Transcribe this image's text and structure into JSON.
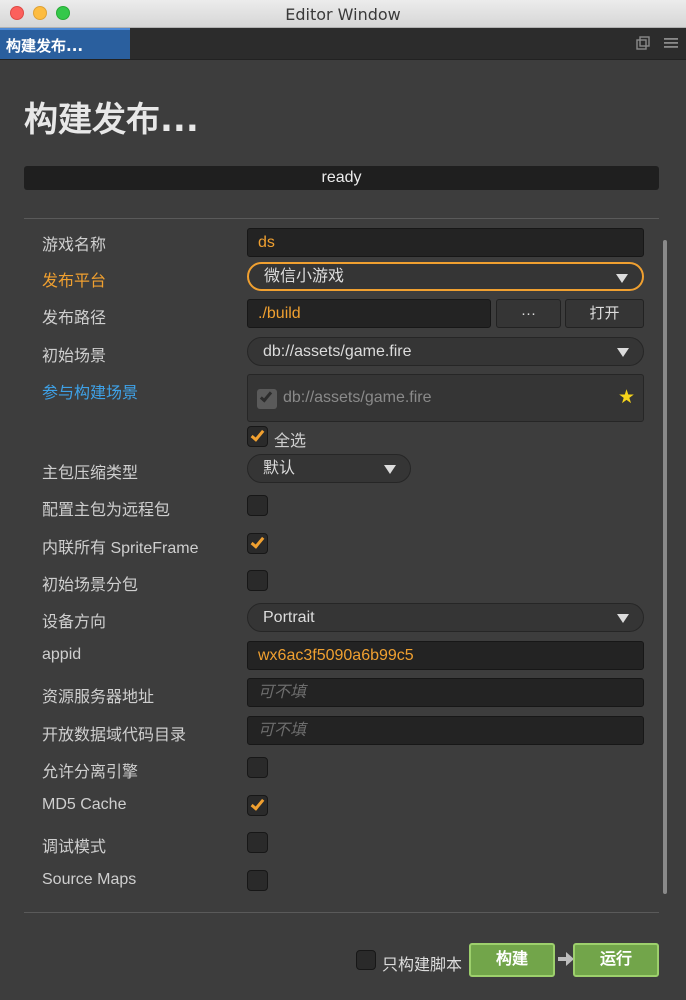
{
  "window": {
    "title": "Editor Window"
  },
  "tab": {
    "label": "构建发布..."
  },
  "page": {
    "title": "构建发布..."
  },
  "progress": {
    "text": "ready"
  },
  "form": {
    "game_name": {
      "label": "游戏名称",
      "value": "ds"
    },
    "platform": {
      "label": "发布平台",
      "value": "微信小游戏"
    },
    "build_path": {
      "label": "发布路径",
      "value": "./build",
      "browse_label": "···",
      "open_label": "打开"
    },
    "start_scene": {
      "label": "初始场景",
      "value": "db://assets/game.fire"
    },
    "included_scenes": {
      "label": "参与构建场景",
      "scene": "db://assets/game.fire",
      "select_all_label": "全选",
      "select_all_checked": true
    },
    "compression": {
      "label": "主包压缩类型",
      "value": "默认"
    },
    "remote_main_bundle": {
      "label": "配置主包为远程包",
      "checked": false
    },
    "inline_spriteframes": {
      "label": "内联所有 SpriteFrame",
      "checked": true
    },
    "subpackage_start_scene": {
      "label": "初始场景分包",
      "checked": false
    },
    "orientation": {
      "label": "设备方向",
      "value": "Portrait"
    },
    "appid": {
      "label": "appid",
      "value": "wx6ac3f5090a6b99c5"
    },
    "remote_server": {
      "label": "资源服务器地址",
      "placeholder": "可不填"
    },
    "open_data_context": {
      "label": "开放数据域代码目录",
      "placeholder": "可不填"
    },
    "separate_engine": {
      "label": "允许分离引擎",
      "checked": false
    },
    "md5_cache": {
      "label": "MD5 Cache",
      "checked": true
    },
    "debug": {
      "label": "调试模式",
      "checked": false
    },
    "source_maps": {
      "label": "Source Maps",
      "checked": false
    }
  },
  "footer": {
    "scripts_only_label": "只构建脚本",
    "scripts_only_checked": false,
    "build_label": "构建",
    "run_label": "运行"
  },
  "colors": {
    "accent": "#f0a030",
    "link": "#3ea2e8",
    "build_green": "#72a54a"
  }
}
